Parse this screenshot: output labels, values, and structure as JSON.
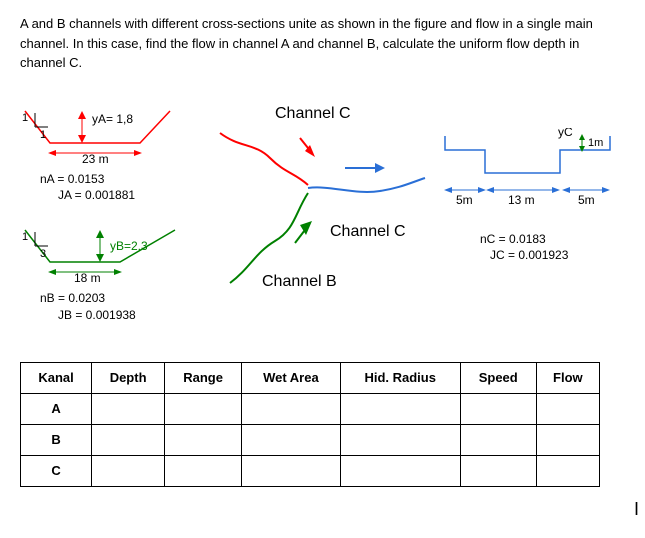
{
  "problem": "A and B channels with different cross-sections unite as shown in the figure and flow in a single main channel. In this case, find the flow in channel A and channel B, calculate the uniform flow depth in channel C.",
  "channelA": {
    "slopeLeft": "1",
    "slopeRight": "1",
    "yLabel": "yA= 1,8",
    "width": "23 m",
    "n": "nA = 0.0153",
    "J": "JA = 0.001881"
  },
  "channelB": {
    "slopeLeft": "1",
    "slopeRight": "3",
    "yLabel": "yB=2,3",
    "width": "18 m",
    "n": "nB = 0.0203",
    "J": "JB = 0.001938"
  },
  "junction": {
    "topLabel": "Channel C",
    "midLabel": "Channel C",
    "bottomLabel": "Channel B"
  },
  "channelC": {
    "yLabel": "yC",
    "depthLabel": "1m",
    "leftBench": "5m",
    "midWidth": "13 m",
    "rightBench": "5m",
    "n": "nC = 0.0183",
    "J": "JC = 0.001923"
  },
  "table": {
    "headers": [
      "Kanal",
      "Depth",
      "Range",
      "Wet Area",
      "Hid. Radius",
      "Speed",
      "Flow"
    ],
    "rows": [
      "A",
      "B",
      "C"
    ]
  }
}
